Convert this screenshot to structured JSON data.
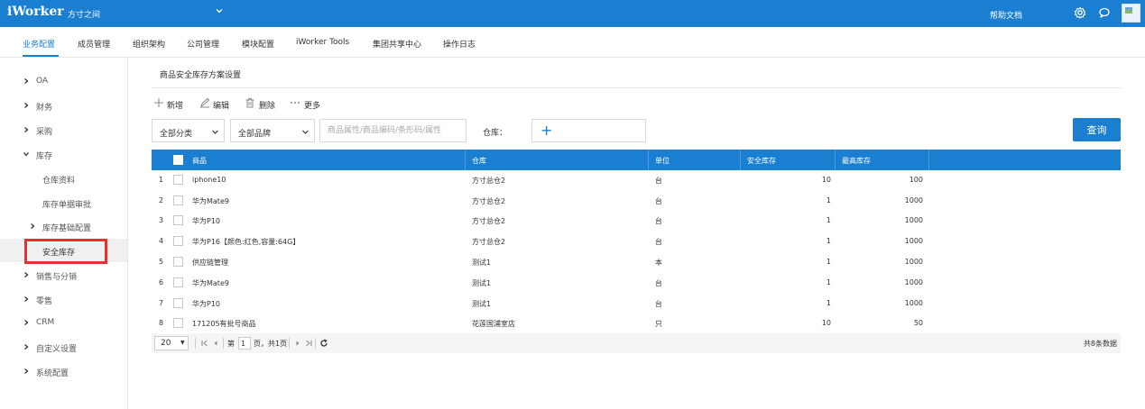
{
  "header": {
    "logo": "iWorker",
    "company": "方寸之间",
    "help": "帮助文档",
    "icons": [
      "settings-icon",
      "chat-icon",
      "avatar"
    ]
  },
  "menu": {
    "items": [
      "业务配置",
      "成员管理",
      "组织架构",
      "公司管理",
      "模块配置",
      "iWorker Tools",
      "集团共享中心",
      "操作日志"
    ],
    "active": "业务配置"
  },
  "sidebar": {
    "items": [
      {
        "label": "OA"
      },
      {
        "label": "财务"
      },
      {
        "label": "采购"
      },
      {
        "label": "库存"
      },
      {
        "label": "仓库资料"
      },
      {
        "label": "库存单据审批"
      },
      {
        "label": "库存基础配置"
      },
      {
        "label": "安全库存"
      },
      {
        "label": "销售与分销"
      },
      {
        "label": "零售"
      },
      {
        "label": "CRM"
      },
      {
        "label": "自定义设置"
      },
      {
        "label": "系统配置"
      }
    ],
    "selected": "安全库存"
  },
  "main": {
    "title": "商品安全库存方案设置",
    "actions": {
      "add": "新增",
      "edit": "编辑",
      "delete": "删除",
      "more": "更多"
    },
    "filters": {
      "category": "全部分类",
      "brand": "全部品牌",
      "search_placeholder": "商品属性/商品编码/条形码/属性",
      "warehouse_label": "仓库：",
      "query": "查询"
    },
    "table": {
      "headers": [
        "商品",
        "仓库",
        "单位",
        "安全库存",
        "最高库存"
      ],
      "rows": [
        {
          "no": "1",
          "product": "iphone10",
          "warehouse": "方寸总仓2",
          "unit": "台",
          "safety": "10",
          "max": "100"
        },
        {
          "no": "2",
          "product": "华为Mate9",
          "warehouse": "方寸总仓2",
          "unit": "台",
          "safety": "1",
          "max": "1000"
        },
        {
          "no": "3",
          "product": "华为P10",
          "warehouse": "方寸总仓2",
          "unit": "台",
          "safety": "1",
          "max": "1000"
        },
        {
          "no": "4",
          "product": "华为P16【颜色:红色,容量:64G】",
          "warehouse": "方寸总仓2",
          "unit": "台",
          "safety": "1",
          "max": "1000"
        },
        {
          "no": "5",
          "product": "供应链管理",
          "warehouse": "测试1",
          "unit": "本",
          "safety": "1",
          "max": "1000"
        },
        {
          "no": "6",
          "product": "华为Mate9",
          "warehouse": "测试1",
          "unit": "台",
          "safety": "1",
          "max": "1000"
        },
        {
          "no": "7",
          "product": "华为P10",
          "warehouse": "测试1",
          "unit": "台",
          "safety": "1",
          "max": "1000"
        },
        {
          "no": "8",
          "product": "171205有批号商品",
          "warehouse": "花莲国浦室店",
          "unit": "只",
          "safety": "10",
          "max": "50"
        }
      ]
    },
    "pager": {
      "page_size": "20",
      "page_prefix": "第",
      "page": "1",
      "page_suffix": "页，共1页",
      "total": "共8条数据"
    }
  }
}
